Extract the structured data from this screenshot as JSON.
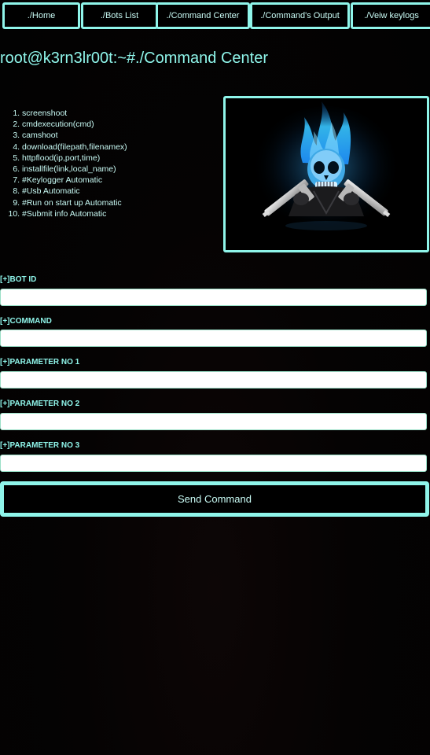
{
  "nav": {
    "items": [
      {
        "label": "./Home"
      },
      {
        "label": "./Bots List"
      },
      {
        "label": "./Command Center"
      },
      {
        "label": "./Command's Output"
      },
      {
        "label": "./Veiw keylogs"
      }
    ]
  },
  "header": {
    "title": "root@k3rn3lr00t:~#./Command Center"
  },
  "commands": [
    "screenshoot",
    "cmdexecution(cmd)",
    "camshoot",
    "download(filepath,filenamex)",
    "httpflood(ip,port,time)",
    "installfile(link,local_name)",
    "#Keylogger Automatic",
    "#Usb Automatic",
    "#Run on start up Automatic",
    "#Submit info Automatic"
  ],
  "form": {
    "bot_id_label": "[+]BOT ID",
    "bot_id_value": "",
    "command_label": "[+]COMMAND",
    "command_value": "",
    "param1_label": "[+]PARAMETER NO 1",
    "param1_value": "",
    "param2_label": "[+]PARAMETER NO 2",
    "param2_value": "",
    "param3_label": "[+]PARAMETER NO 3",
    "param3_value": "",
    "submit_label": "Send Command"
  },
  "colors": {
    "accent": "#8ff5ea",
    "text": "#c9fbf5",
    "background": "#030303"
  },
  "icons": {
    "banner": "flaming-skull-with-pistols-image"
  }
}
